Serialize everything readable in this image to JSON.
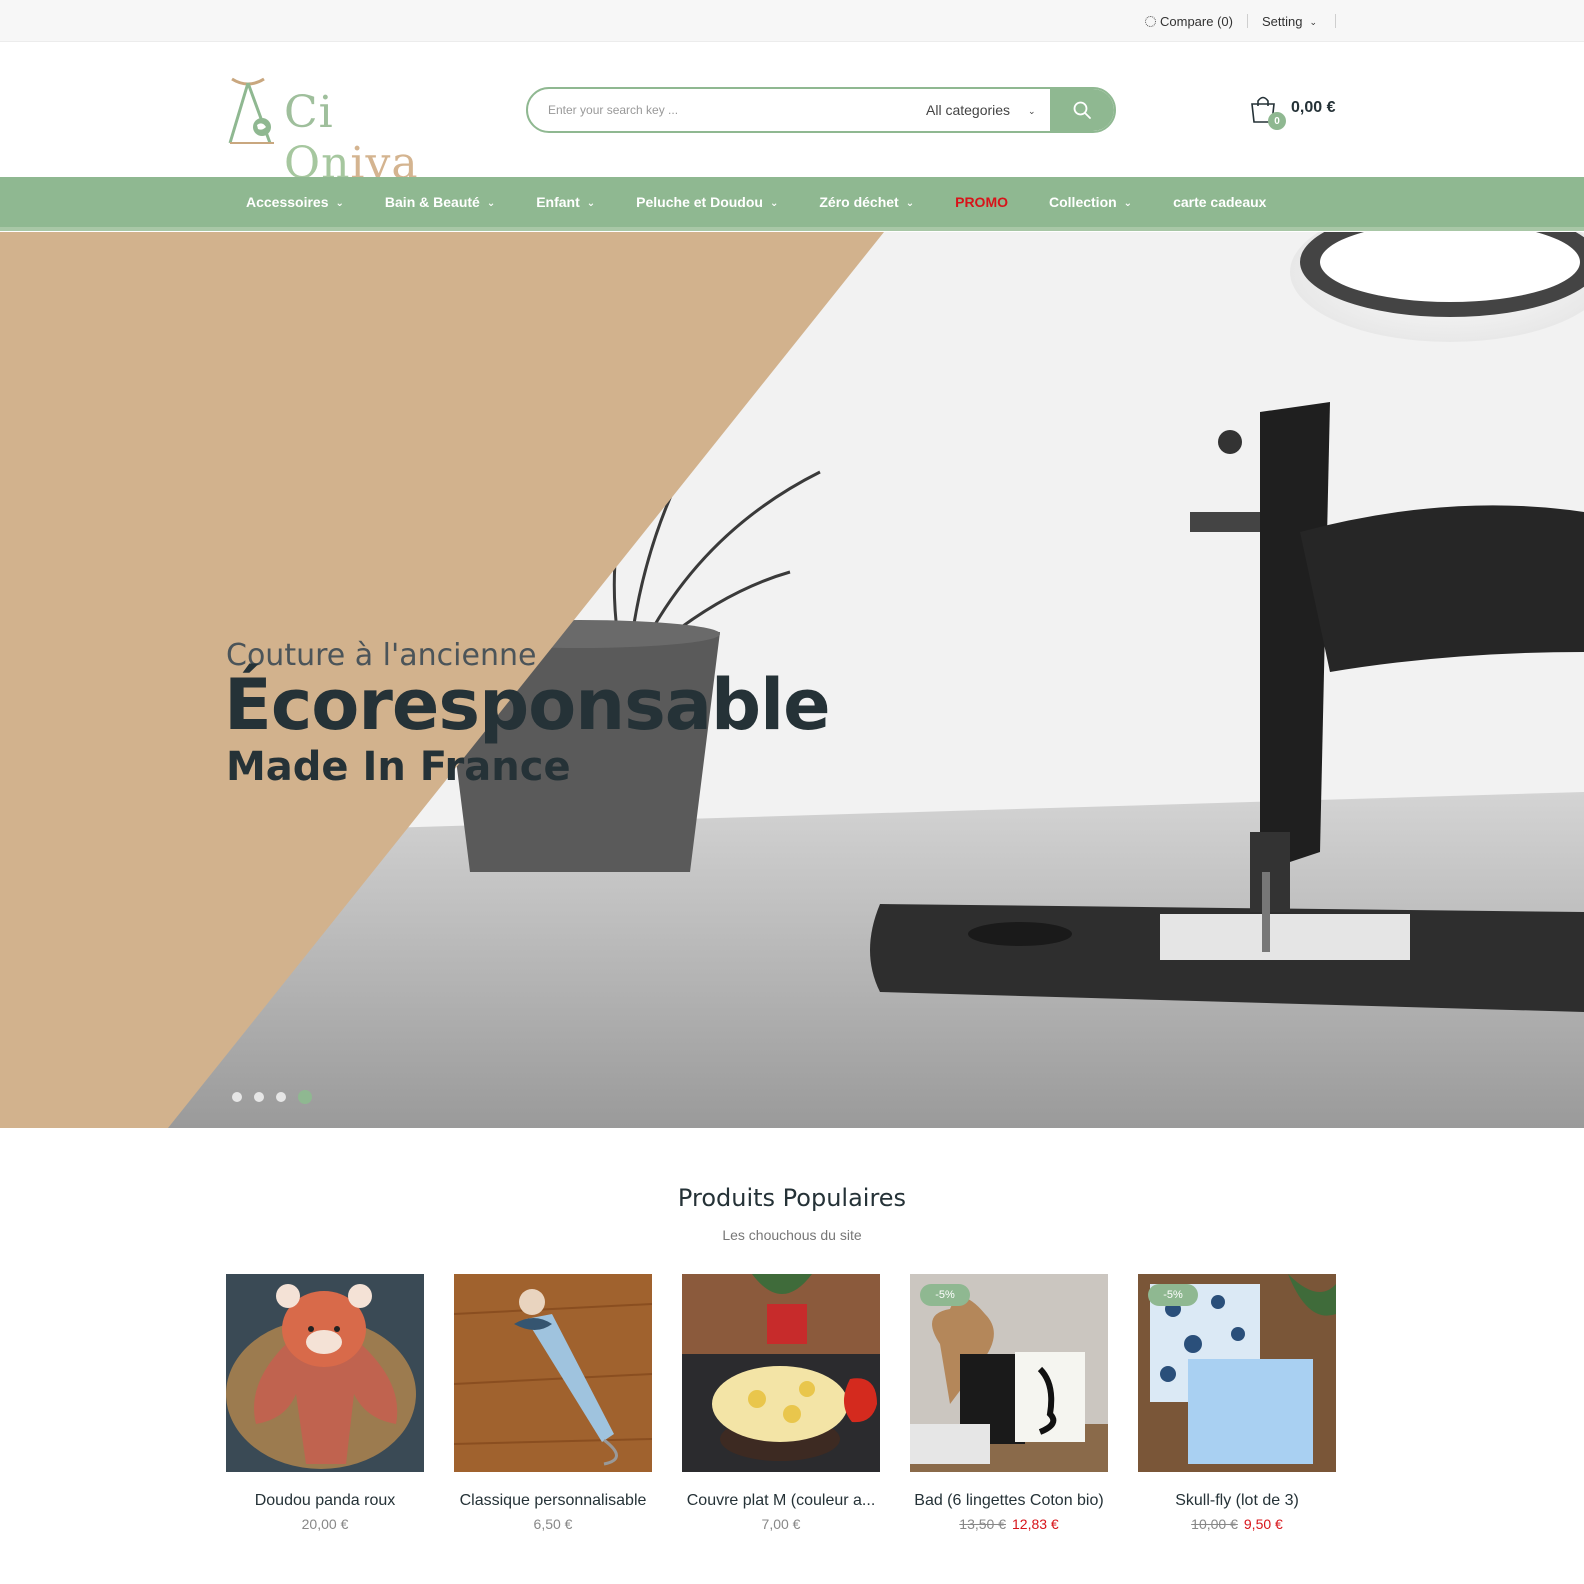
{
  "topbar": {
    "compare_label": "Compare (0)",
    "setting_label": "Setting"
  },
  "header": {
    "logo_text": {
      "part1": "Ci ",
      "part2": "On",
      "part3": "iya"
    },
    "search": {
      "placeholder": "Enter your search key ...",
      "category": "All categories"
    },
    "cart": {
      "count": "0",
      "amount": "0,00 €"
    }
  },
  "nav": {
    "items": [
      {
        "label": "Accessoires",
        "has_dropdown": true
      },
      {
        "label": "Bain & Beauté",
        "has_dropdown": true
      },
      {
        "label": "Enfant",
        "has_dropdown": true
      },
      {
        "label": "Peluche et Doudou",
        "has_dropdown": true
      },
      {
        "label": "Zéro déchet",
        "has_dropdown": true
      },
      {
        "label": "PROMO",
        "has_dropdown": false
      },
      {
        "label": "Collection",
        "has_dropdown": true
      },
      {
        "label": "carte cadeaux",
        "has_dropdown": false
      }
    ]
  },
  "hero": {
    "line1": "Couture à l'ancienne",
    "line2": "Écoresponsable",
    "line3": "Made In France",
    "slides": 4,
    "active_slide": 4
  },
  "products_section": {
    "title": "Produits Populaires",
    "subtitle": "Les chouchous du site",
    "items": [
      {
        "name": "Doudou panda roux",
        "price": "20,00 €",
        "old_price": "",
        "sale_badge": ""
      },
      {
        "name": "Classique personnalisable",
        "price": "6,50 €",
        "old_price": "",
        "sale_badge": ""
      },
      {
        "name": "Couvre plat M (couleur a...",
        "price": "7,00 €",
        "old_price": "",
        "sale_badge": ""
      },
      {
        "name": "Bad (6 lingettes Coton bio)",
        "price": "12,83 €",
        "old_price": "13,50 €",
        "sale_badge": "-5%"
      },
      {
        "name": "Skull-fly (lot de 3)",
        "price": "9,50 €",
        "old_price": "10,00 €",
        "sale_badge": "-5%"
      }
    ]
  },
  "colors": {
    "brand_green": "#8fb891",
    "promo_red": "#d7141a",
    "hero_tan": "#d2b28d",
    "text_dark": "#253237"
  }
}
